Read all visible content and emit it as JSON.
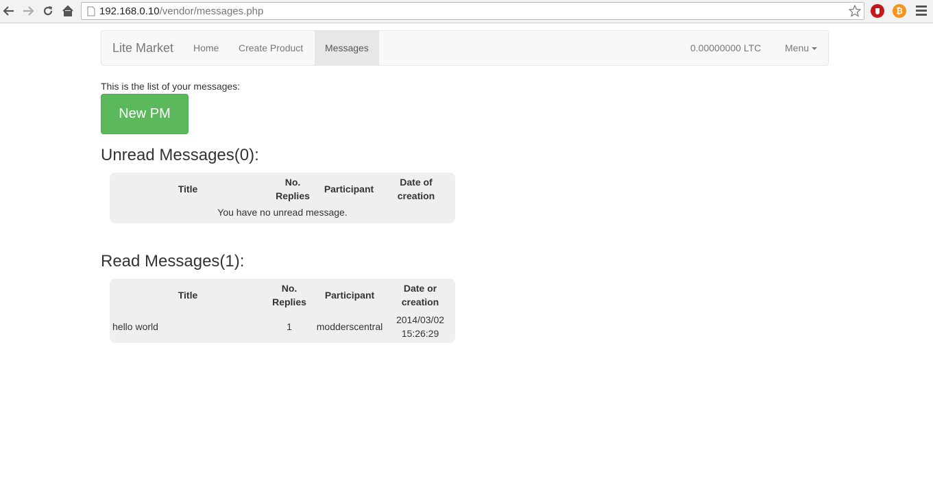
{
  "browser": {
    "url_host": "192.168.0.10",
    "url_path": "/vendor/messages.php"
  },
  "navbar": {
    "brand": "Lite Market",
    "links": [
      "Home",
      "Create Product",
      "Messages"
    ],
    "balance": "0.00000000 LTC",
    "menu_label": "Menu"
  },
  "content": {
    "intro_text": "This is the list of your messages:",
    "new_pm_label": "New PM",
    "unread": {
      "title": "Unread Messages(0):",
      "columns": {
        "title": "Title",
        "replies_line1": "No.",
        "replies_line2": "Replies",
        "participant": "Participant",
        "date_line1": "Date of",
        "date_line2": "creation"
      },
      "empty_text": "You have no unread message."
    },
    "read": {
      "title": "Read Messages(1):",
      "columns": {
        "title": "Title",
        "replies_line1": "No.",
        "replies_line2": "Replies",
        "participant": "Participant",
        "date_line1": "Date or",
        "date_line2": "creation"
      },
      "rows": [
        {
          "title": "hello world",
          "replies": "1",
          "participant": "modderscentral",
          "date_line1": "2014/03/02",
          "date_line2": "15:26:29"
        }
      ]
    }
  }
}
